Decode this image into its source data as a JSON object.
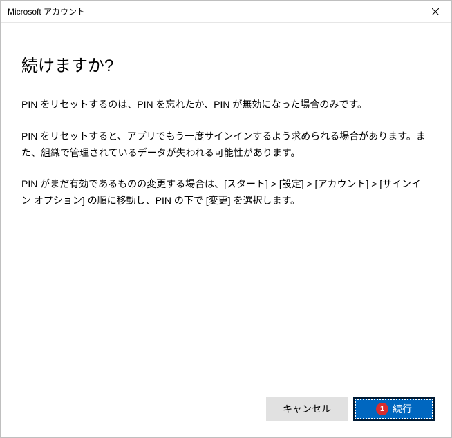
{
  "titlebar": {
    "title": "Microsoft アカウント"
  },
  "content": {
    "heading": "続けますか?",
    "para1": "PIN をリセットするのは、PIN を忘れたか、PIN が無効になった場合のみです。",
    "para2": "PIN をリセットすると、アプリでもう一度サインインするよう求められる場合があります。また、組織で管理されているデータが失われる可能性があります。",
    "para3": "PIN がまだ有効であるものの変更する場合は、[スタート] > [設定] > [アカウント] > [サインイン オプション] の順に移動し、PIN の下で [変更] を選択します。"
  },
  "buttons": {
    "cancel": "キャンセル",
    "continue": "続行"
  },
  "annotation": {
    "step": "1"
  }
}
